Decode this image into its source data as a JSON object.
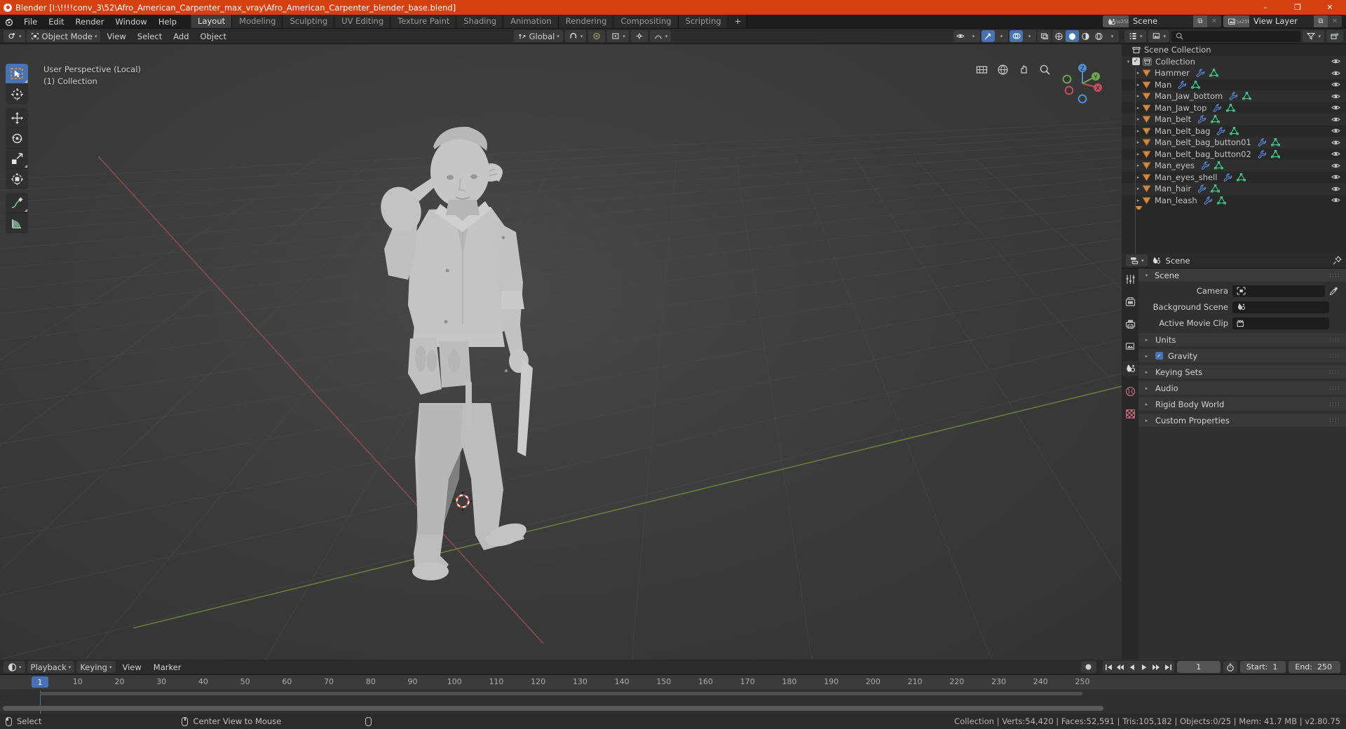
{
  "window": {
    "title": "Blender [I:\\!!!!conv_3\\52\\Afro_American_Carpenter_max_vray\\Afro_American_Carpenter_blender_base.blend]",
    "minimize": "–",
    "maximize": "❐",
    "close": "✕",
    "accent": "#d4400f"
  },
  "topbar": {
    "menus": [
      "File",
      "Edit",
      "Render",
      "Window",
      "Help"
    ],
    "workspaces": [
      {
        "label": "Layout",
        "active": true
      },
      {
        "label": "Modeling",
        "active": false
      },
      {
        "label": "Sculpting",
        "active": false
      },
      {
        "label": "UV Editing",
        "active": false
      },
      {
        "label": "Texture Paint",
        "active": false
      },
      {
        "label": "Shading",
        "active": false
      },
      {
        "label": "Animation",
        "active": false
      },
      {
        "label": "Rendering",
        "active": false
      },
      {
        "label": "Compositing",
        "active": false
      },
      {
        "label": "Scripting",
        "active": false
      }
    ],
    "add_workspace": "+",
    "scene_label": "Scene",
    "view_layer_label": "View Layer",
    "new_copy_icon": "⧉",
    "unlink_icon": "✕"
  },
  "viewport": {
    "mode": "Object Mode",
    "menus": [
      "View",
      "Select",
      "Add",
      "Object"
    ],
    "transform_orientation": "Global",
    "snap_icon": "magnet-icon",
    "proportional_icon": "proportional-edit-icon",
    "overlay_text_line1": "User Perspective (Local)",
    "overlay_text_line2": "(1) Collection",
    "gizmo_axes": {
      "x": "X",
      "y": "Y",
      "z": "Z"
    },
    "tools": [
      {
        "name": "select-box-tool",
        "active": true
      },
      {
        "name": "cursor-tool",
        "active": false
      },
      {
        "name": "move-tool",
        "active": false
      },
      {
        "name": "rotate-tool",
        "active": false
      },
      {
        "name": "scale-tool",
        "active": false
      },
      {
        "name": "transform-tool",
        "active": false
      },
      {
        "name": "annotate-tool",
        "active": false
      },
      {
        "name": "measure-tool",
        "active": false
      }
    ],
    "shading_modes": [
      "wireframe",
      "solid",
      "material-preview",
      "rendered"
    ],
    "shading_active": "solid"
  },
  "outliner": {
    "search_placeholder": "",
    "display_mode": "View Layer",
    "root": "Scene Collection",
    "collection": "Collection",
    "items": [
      {
        "label": "Hammer",
        "indent": 2
      },
      {
        "label": "Man",
        "indent": 2
      },
      {
        "label": "Man_Jaw_bottom",
        "indent": 2
      },
      {
        "label": "Man_Jaw_top",
        "indent": 2
      },
      {
        "label": "Man_belt",
        "indent": 2
      },
      {
        "label": "Man_belt_bag",
        "indent": 2
      },
      {
        "label": "Man_belt_bag_button01",
        "indent": 2
      },
      {
        "label": "Man_belt_bag_button02",
        "indent": 2
      },
      {
        "label": "Man_eyes",
        "indent": 2
      },
      {
        "label": "Man_eyes_shell",
        "indent": 2
      },
      {
        "label": "Man_hair",
        "indent": 2
      },
      {
        "label": "Man_leash",
        "indent": 2
      }
    ]
  },
  "properties": {
    "breadcrumb": "Scene",
    "panel_title": "Scene",
    "rows": [
      {
        "label": "Camera",
        "value": "",
        "icon": "camera-data-icon",
        "eyedropper": true
      },
      {
        "label": "Background Scene",
        "value": "",
        "icon": "scene-icon",
        "eyedropper": false
      },
      {
        "label": "Active Movie Clip",
        "value": "",
        "icon": "clip-icon",
        "eyedropper": false
      }
    ],
    "sections": [
      {
        "label": "Units",
        "checkbox": false
      },
      {
        "label": "Gravity",
        "checkbox": true
      },
      {
        "label": "Keying Sets",
        "checkbox": false
      },
      {
        "label": "Audio",
        "checkbox": false
      },
      {
        "label": "Rigid Body World",
        "checkbox": false
      },
      {
        "label": "Custom Properties",
        "checkbox": false
      }
    ],
    "tabs": [
      {
        "name": "tool-tab",
        "glyph": "⚒",
        "active": false
      },
      {
        "name": "render-tab",
        "glyph": "▣",
        "active": false
      },
      {
        "name": "output-tab",
        "glyph": "⎙",
        "active": false
      },
      {
        "name": "view-layer-tab",
        "glyph": "☷",
        "active": false
      },
      {
        "name": "scene-tab",
        "glyph": "◔",
        "active": true
      },
      {
        "name": "world-tab",
        "glyph": "◍",
        "active": false
      },
      {
        "name": "texture-tab",
        "glyph": "▦",
        "active": false
      }
    ]
  },
  "timeline": {
    "editor_type": "timeline-icon",
    "menus": [
      "Playback",
      "Keying",
      "View",
      "Marker"
    ],
    "current_frame": "1",
    "start_label": "Start:",
    "start_value": "1",
    "end_label": "End:",
    "end_value": "250",
    "auto_key_icon": "record-icon",
    "ticks": [
      10,
      20,
      30,
      40,
      50,
      60,
      70,
      80,
      90,
      100,
      110,
      120,
      130,
      140,
      150,
      160,
      170,
      180,
      190,
      200,
      210,
      220,
      230,
      240,
      250
    ],
    "playhead_label": "1"
  },
  "statusbar": {
    "left_items": [
      {
        "icon": "mouse-left-icon",
        "label": "Select"
      },
      {
        "icon": "mouse-middle-icon",
        "label": "Center View to Mouse"
      },
      {
        "icon": "mouse-right-icon",
        "label": ""
      }
    ],
    "stats": "Collection | Verts:54,420 | Faces:52,591 | Tris:105,182 | Objects:0/25 | Mem: 41.7 MB | v2.80.75"
  }
}
